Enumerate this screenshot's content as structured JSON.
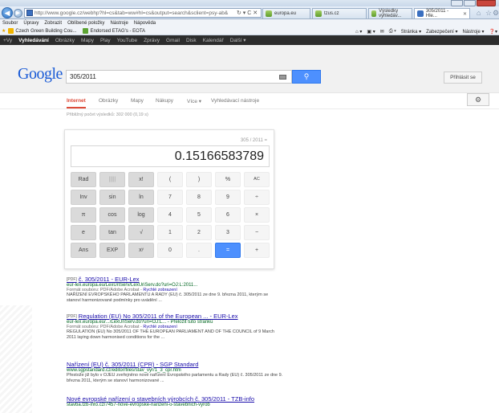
{
  "browser": {
    "url": "http://www.google.cz/webhp?hl=cs&tab=ww#hl=cs&output=search&sclient=psy-ab&",
    "addr_controls": "↻ ▾ C ✕",
    "tabs": [
      {
        "label": "europa.eu"
      },
      {
        "label": "tzus.cz"
      },
      {
        "label": "Výsledky vyhledáv..."
      },
      {
        "label": "305/2011 - Hle...",
        "close": "✕"
      }
    ],
    "menu": [
      "Soubor",
      "Úpravy",
      "Zobrazit",
      "Oblíbené položky",
      "Nástroje",
      "Nápověda"
    ],
    "favorites": [
      {
        "label": "Czech Green Building Cou...",
        "color": "#f0b400"
      },
      {
        "label": "Endorsed ETAG's - EOTA",
        "color": "#5da434"
      }
    ],
    "commands": [
      "Stránka ▾",
      "Zabezpečení ▾",
      "Nástroje ▾"
    ]
  },
  "gbar": [
    "+Vy",
    "Vyhledávání",
    "Obrázky",
    "Mapy",
    "Play",
    "YouTube",
    "Zprávy",
    "Gmail",
    "Disk",
    "Kalendář",
    "Další ▾"
  ],
  "google": {
    "logo": "Google",
    "query": "305/2011",
    "signin": "Přihlásit se"
  },
  "search_tabs": [
    "Internet",
    "Obrázky",
    "Mapy",
    "Nákupy",
    "Více ▾",
    "Vyhledávací nástroje"
  ],
  "stats": "Přibližný počet výsledků: 302 000 (0,19 s)",
  "calculator": {
    "expression": "305 / 2011 =",
    "display": "0.15166583789",
    "keys": [
      [
        "Rad",
        "|||||",
        "x!",
        "(",
        ")",
        "%",
        "AC"
      ],
      [
        "Inv",
        "sin",
        "ln",
        "7",
        "8",
        "9",
        "÷"
      ],
      [
        "π",
        "cos",
        "log",
        "4",
        "5",
        "6",
        "×"
      ],
      [
        "e",
        "tan",
        "√",
        "1",
        "2",
        "3",
        "−"
      ],
      [
        "Ans",
        "EXP",
        "xʸ",
        "0",
        ".",
        "=",
        "+"
      ]
    ]
  },
  "results": [
    {
      "pdf": "[PDF]",
      "title": "č. 305/2011 - EUR-Lex",
      "url": "eur-lex.europa.eu/LexUriServ/LexUriServ.do?uri=OJ:L:2011...",
      "meta": "Formát souboru: PDF/Adobe Acrobat - ",
      "meta_link": "Rychlé zobrazení",
      "snippet": "NAŘÍZENÍ EVROPSKÉHO PARLAMENTU A RADY (EU) č. 305/2011 ze dne 9. března 2011, kterým se stanoví harmonizované podmínky pro uvádění ..."
    },
    {
      "pdf": "[PDF]",
      "title": "Regulation (EU) No 305/2011 of the European ... - EUR-Lex",
      "url": "eur-lex.europa.eu/.../LexUriServ.do?uri=OJ:L... - Přeložit tuto stránku",
      "meta": "Formát souboru: PDF/Adobe Acrobat - ",
      "meta_link": "Rychlé zobrazení",
      "snippet": "REGULATION (EU) No 305/2011 OF THE EUROPEAN PARLIAMENT AND OF THE COUNCIL of 9 March 2011 laying down harmonised conditions for the ..."
    },
    {
      "pdf": "",
      "title": "Nařízení (EU) č. 305/2011 (CPR) - SGP Standard",
      "url": "www.sgpstandard.cz/editor/files/stav_vyr/1_3_cpr.htm",
      "meta": "",
      "meta_link": "",
      "snippet": "Přestože již bylo v OJEU zveřejněno nové nařízení Evropského parlamentu a Rady (EU) č. 305/2011 ze dne 9. března 2011, kterým se stanoví harmonizované ..."
    },
    {
      "pdf": "",
      "title": "Nové evropské nařízení o stavebních výrobcích č. 305/2011 - TZB-info",
      "url": "stavba.tzb-info.cz/7457-nove-evropske-narizeni-o-stavebnich-vyrob",
      "meta": "",
      "meta_link": "",
      "snippet": ""
    }
  ]
}
